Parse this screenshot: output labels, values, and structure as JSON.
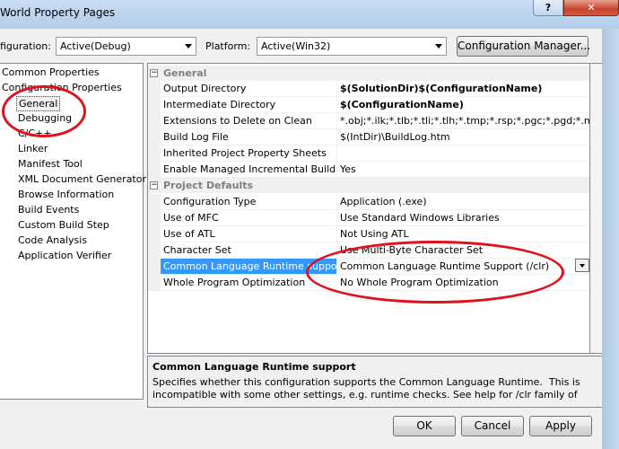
{
  "window": {
    "title": "World Property Pages",
    "help_label": "?",
    "close_label": "✕"
  },
  "toolbar": {
    "configuration_label": "figuration:",
    "configuration_value": "Active(Debug)",
    "platform_label": "Platform:",
    "platform_value": "Active(Win32)",
    "config_manager_label": "Configuration Manager..."
  },
  "tree": {
    "items": [
      {
        "label": "Common Properties"
      },
      {
        "label": "Configuration Properties"
      },
      {
        "label": "General"
      },
      {
        "label": "Debugging"
      },
      {
        "label": "C/C++"
      },
      {
        "label": "Linker"
      },
      {
        "label": "Manifest Tool"
      },
      {
        "label": "XML Document Generator"
      },
      {
        "label": "Browse Information"
      },
      {
        "label": "Build Events"
      },
      {
        "label": "Custom Build Step"
      },
      {
        "label": "Code Analysis"
      },
      {
        "label": "Application Verifier"
      }
    ]
  },
  "grid": {
    "categories": [
      {
        "label": "General",
        "toggle": "−",
        "rows": [
          {
            "name": "Output Directory",
            "value": "$(SolutionDir)$(ConfigurationName)",
            "bold": true
          },
          {
            "name": "Intermediate Directory",
            "value": "$(ConfigurationName)",
            "bold": true
          },
          {
            "name": "Extensions to Delete on Clean",
            "value": "*.obj;*.ilk;*.tlb;*.tli;*.tlh;*.tmp;*.rsp;*.pgc;*.pgd;*.meta;$(",
            "bold": false
          },
          {
            "name": "Build Log File",
            "value": "$(IntDir)\\BuildLog.htm",
            "bold": false
          },
          {
            "name": "Inherited Project Property Sheets",
            "value": "",
            "bold": false
          },
          {
            "name": "Enable Managed Incremental Build",
            "value": "Yes",
            "bold": false
          }
        ]
      },
      {
        "label": "Project Defaults",
        "toggle": "−",
        "rows": [
          {
            "name": "Configuration Type",
            "value": "Application (.exe)",
            "bold": false
          },
          {
            "name": "Use of MFC",
            "value": "Use Standard Windows Libraries",
            "bold": false
          },
          {
            "name": "Use of ATL",
            "value": "Not Using ATL",
            "bold": false
          },
          {
            "name": "Character Set",
            "value": "Use Multi-Byte Character Set",
            "bold": false
          },
          {
            "name": "Common Language Runtime support",
            "value": "Common Language Runtime Support (/clr)",
            "bold": false
          },
          {
            "name": "Whole Program Optimization",
            "value": "No Whole Program Optimization",
            "bold": false
          }
        ]
      }
    ]
  },
  "description": {
    "title": "Common Language Runtime support",
    "text": "Specifies whether this configuration supports the Common Language Runtime.  This is\nincompatible with some other settings, e.g. runtime checks. See help for /clr family of C++ co..."
  },
  "buttons": {
    "ok": "OK",
    "cancel": "Cancel",
    "apply": "Apply"
  },
  "annotations": {
    "color": "#e0101c"
  }
}
